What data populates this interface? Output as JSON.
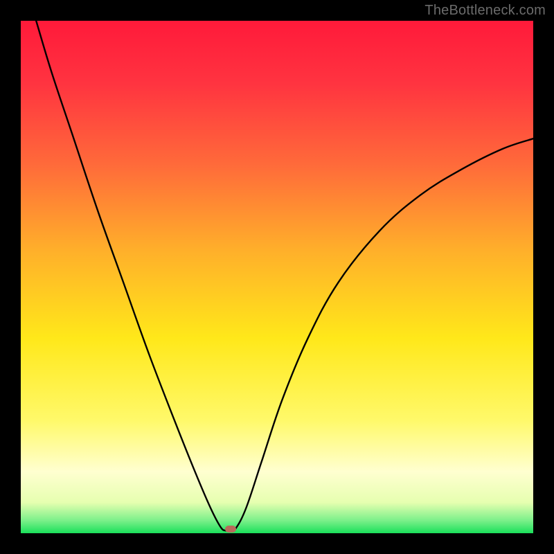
{
  "watermark": "TheBottleneck.com",
  "chart_data": {
    "type": "line",
    "title": "",
    "xlabel": "",
    "ylabel": "",
    "xlim": [
      0,
      100
    ],
    "ylim": [
      0,
      100
    ],
    "gradient_stops": [
      {
        "offset": 0,
        "color": "#ff1a3a"
      },
      {
        "offset": 0.12,
        "color": "#ff3340"
      },
      {
        "offset": 0.28,
        "color": "#ff6a3a"
      },
      {
        "offset": 0.45,
        "color": "#ffb02a"
      },
      {
        "offset": 0.62,
        "color": "#ffe81a"
      },
      {
        "offset": 0.78,
        "color": "#fff96a"
      },
      {
        "offset": 0.88,
        "color": "#ffffd0"
      },
      {
        "offset": 0.94,
        "color": "#e6ffb0"
      },
      {
        "offset": 0.975,
        "color": "#7cf08a"
      },
      {
        "offset": 1.0,
        "color": "#1ae05a"
      }
    ],
    "series": [
      {
        "name": "bottleneck-curve",
        "stroke": "#000000",
        "stroke_width": 2.4,
        "points": [
          {
            "x": 3,
            "y": 100
          },
          {
            "x": 6,
            "y": 90
          },
          {
            "x": 10,
            "y": 78
          },
          {
            "x": 15,
            "y": 63
          },
          {
            "x": 20,
            "y": 49
          },
          {
            "x": 25,
            "y": 35
          },
          {
            "x": 30,
            "y": 22
          },
          {
            "x": 34,
            "y": 12
          },
          {
            "x": 37,
            "y": 5
          },
          {
            "x": 39,
            "y": 1.2
          },
          {
            "x": 40,
            "y": 0.5
          },
          {
            "x": 41,
            "y": 0.5
          },
          {
            "x": 42,
            "y": 1.0
          },
          {
            "x": 44,
            "y": 5
          },
          {
            "x": 47,
            "y": 14
          },
          {
            "x": 51,
            "y": 26
          },
          {
            "x": 56,
            "y": 38
          },
          {
            "x": 62,
            "y": 49
          },
          {
            "x": 70,
            "y": 59
          },
          {
            "x": 78,
            "y": 66
          },
          {
            "x": 86,
            "y": 71
          },
          {
            "x": 94,
            "y": 75
          },
          {
            "x": 100,
            "y": 77
          }
        ]
      }
    ],
    "marker": {
      "x": 41,
      "y": 0.8,
      "color": "#b86a5a"
    }
  }
}
